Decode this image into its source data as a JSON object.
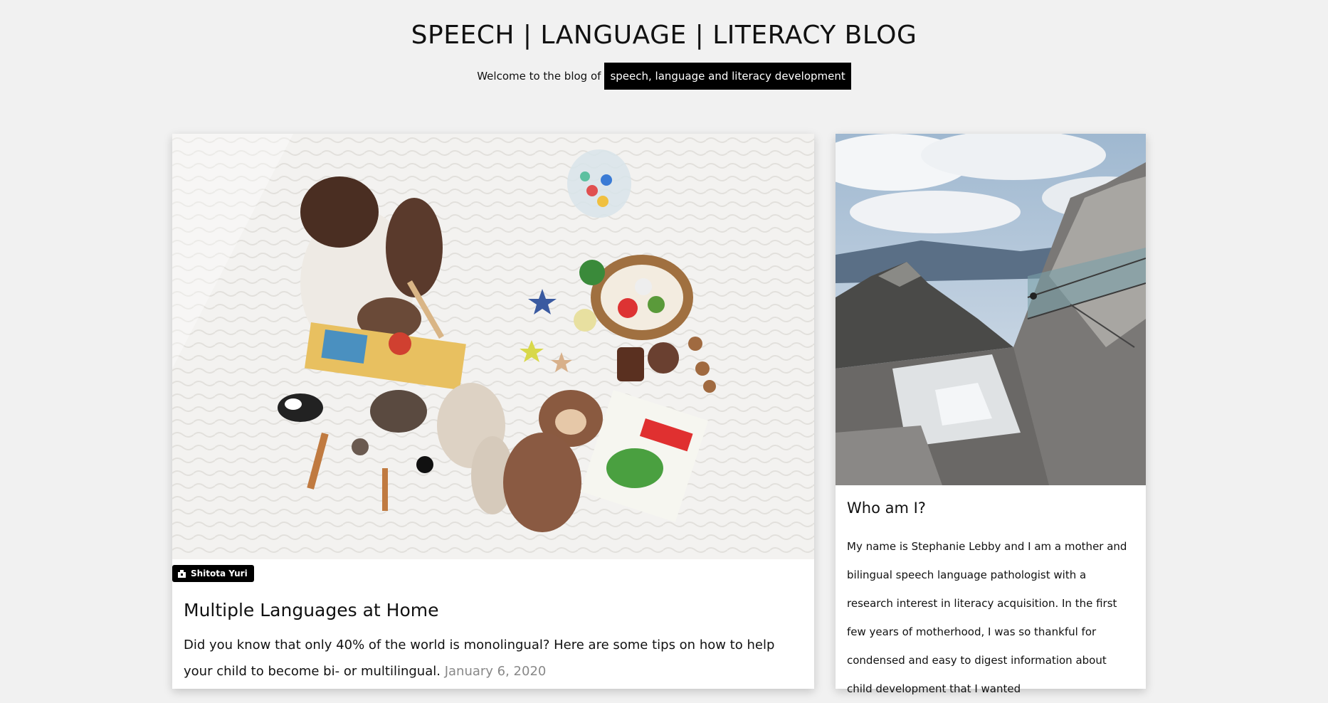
{
  "header": {
    "title": "SPEECH | LANGUAGE | LITERACY BLOG",
    "tagline_prefix": "Welcome to the blog of",
    "tagline_highlight": "speech, language and literacy development"
  },
  "post": {
    "photo_credit": "Shitota Yuri",
    "title": "Multiple Languages at Home",
    "excerpt": "Did you know that only 40% of the world is monolingual? Here are some tips on how to help your child to become bi- or multilingual.",
    "date": "January 6, 2020"
  },
  "about": {
    "title": "Who am I?",
    "text": "My name is Stephanie Lebby and I am a mother and bilingual speech language pathologist with a research interest in literacy acquisition. In the first few years of motherhood, I was so thankful for condensed and easy to digest information about child development that I wanted"
  },
  "icons": {
    "camera": "camera-icon"
  }
}
